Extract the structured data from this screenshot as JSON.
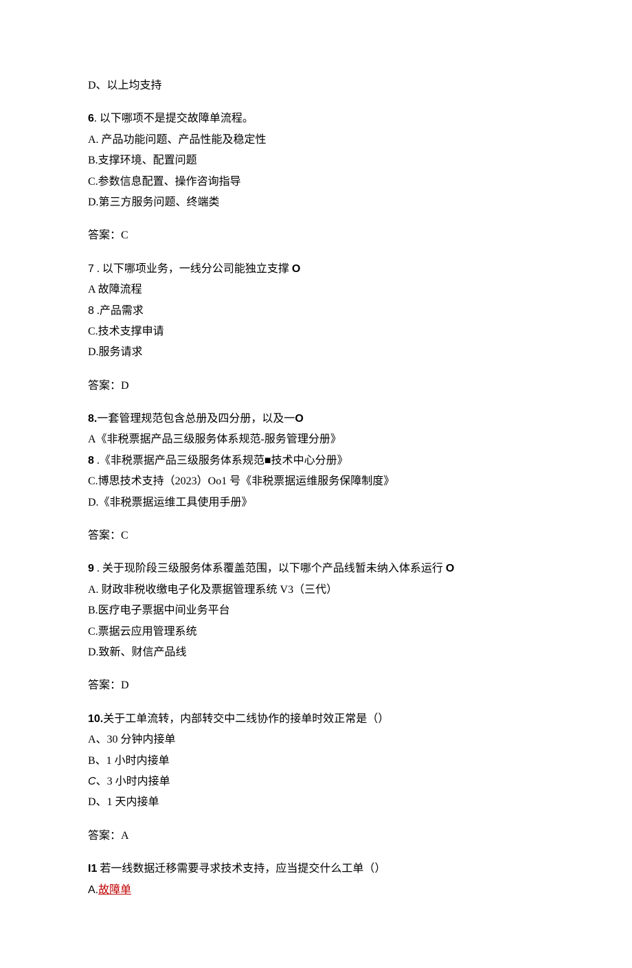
{
  "q5": {
    "opt_d": "D、以上均支持"
  },
  "q6": {
    "stem_num": "6",
    "stem_text": ". 以下哪项不是提交故障单流程。",
    "opt_a": "A. 产品功能问题、产品性能及稳定性",
    "opt_b": "B.支撑环境、配置问题",
    "opt_c": "C.参数信息配置、操作咨询指导",
    "opt_d": "D.第三方服务问题、终端类",
    "answer": "答案：C"
  },
  "q7": {
    "stem_num": "7",
    "stem_text": " . 以下哪项业务，一线分公司能独立支撑 ",
    "stem_suffix": "O",
    "opt_a": "A 故障流程",
    "opt_b_num": "8",
    "opt_b_text": " .产品需求",
    "opt_c": "C.技术支撑申请",
    "opt_d": "D.服务请求",
    "answer": "答案：D"
  },
  "q8": {
    "stem_num": "8.",
    "stem_text": "一套管理规范包含总册及四分册，以及一",
    "stem_suffix": "O",
    "opt_a": "A《非税票据产品三级服务体系规范-服务管理分册》",
    "opt_b_num": "8",
    "opt_b_text": " .《非税票据产品三级服务体系规范■技术中心分册》",
    "opt_c": "C.博思技术支持（2023）Oo1 号《非税票据运维服务保障制度》",
    "opt_d": "D.《非税票据运维工具使用手册》",
    "answer": "答案：C"
  },
  "q9": {
    "stem_num": "9",
    "stem_text": " . 关于现阶段三级服务体系覆盖范围，以下哪个产品线暂未纳入体系运行 ",
    "stem_suffix": "O",
    "opt_a": "A. 财政非税收缴电子化及票据管理系统 V3（三代）",
    "opt_b": "B.医疗电子票据中间业务平台",
    "opt_c": "C.票据云应用管理系统",
    "opt_d": "D.致新、财信产品线",
    "answer": "答案：D"
  },
  "q10": {
    "stem_num": "10.",
    "stem_text": "关于工单流转，内部转交中二线协作的接单时效正常是（）",
    "opt_a": "A、30 分钟内接单",
    "opt_b": "B、1 小时内接单",
    "opt_c_prefix": "C",
    "opt_c_text": "、3 小时内接单",
    "opt_d": "D、1 天内接单",
    "answer": "答案：A"
  },
  "q11": {
    "stem_num": "I1",
    "stem_text": " 若一线数据迁移需要寻求技术支持，应当提交什么工单（）",
    "opt_a_prefix": "A.",
    "opt_a_text": "故障单"
  }
}
